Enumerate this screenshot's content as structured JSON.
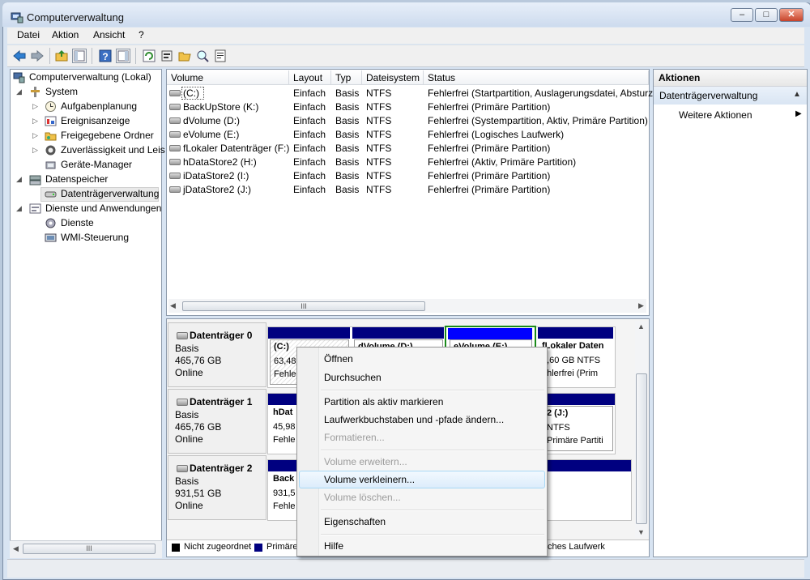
{
  "window": {
    "title": "Computerverwaltung",
    "min": "–",
    "max": "□",
    "close": "✕"
  },
  "menu": [
    "Datei",
    "Aktion",
    "Ansicht",
    "?"
  ],
  "toolbar_icons": [
    "back-arrow-icon",
    "forward-arrow-icon",
    "up-folder-icon",
    "show-hide-tree-icon",
    "help-icon",
    "show-hide-actions-icon",
    "refresh-icon",
    "properties-icon",
    "open-folder-icon",
    "search-icon",
    "properties-sheet-icon"
  ],
  "tree": {
    "root": "Computerverwaltung (Lokal)",
    "system": "System",
    "aufgaben": "Aufgabenplanung",
    "ereignis": "Ereignisanzeige",
    "freigabe": "Freigegebene Ordner",
    "zuverl": "Zuverlässigkeit und Leis",
    "geraete": "Geräte-Manager",
    "datenspeicher": "Datenspeicher",
    "datentraeger": "Datenträgerverwaltung",
    "dienste_anw": "Dienste und Anwendungen",
    "dienste": "Dienste",
    "wmi": "WMI-Steuerung"
  },
  "columns": {
    "volume": "Volume",
    "layout": "Layout",
    "typ": "Typ",
    "fs": "Dateisystem",
    "status": "Status"
  },
  "rows": [
    {
      "volume": "(C:)",
      "layout": "Einfach",
      "typ": "Basis",
      "fs": "NTFS",
      "status": "Fehlerfrei (Startpartition, Auslagerungsdatei, Absturz"
    },
    {
      "volume": "BackUpStore (K:)",
      "layout": "Einfach",
      "typ": "Basis",
      "fs": "NTFS",
      "status": "Fehlerfrei (Primäre Partition)"
    },
    {
      "volume": "dVolume (D:)",
      "layout": "Einfach",
      "typ": "Basis",
      "fs": "NTFS",
      "status": "Fehlerfrei (Systempartition, Aktiv, Primäre Partition)"
    },
    {
      "volume": "eVolume (E:)",
      "layout": "Einfach",
      "typ": "Basis",
      "fs": "NTFS",
      "status": "Fehlerfrei (Logisches Laufwerk)"
    },
    {
      "volume": "fLokaler Datenträger (F:)",
      "layout": "Einfach",
      "typ": "Basis",
      "fs": "NTFS",
      "status": "Fehlerfrei (Primäre Partition)"
    },
    {
      "volume": "hDataStore2 (H:)",
      "layout": "Einfach",
      "typ": "Basis",
      "fs": "NTFS",
      "status": "Fehlerfrei (Aktiv, Primäre Partition)"
    },
    {
      "volume": "iDataStore2 (I:)",
      "layout": "Einfach",
      "typ": "Basis",
      "fs": "NTFS",
      "status": "Fehlerfrei (Primäre Partition)"
    },
    {
      "volume": "jDataStore2 (J:)",
      "layout": "Einfach",
      "typ": "Basis",
      "fs": "NTFS",
      "status": "Fehlerfrei (Primäre Partition)"
    }
  ],
  "hscroll_grip": "III",
  "disks": [
    {
      "name": "Datenträger 0",
      "type": "Basis",
      "size": "465,76 GB",
      "state": "Online"
    },
    {
      "name": "Datenträger 1",
      "type": "Basis",
      "size": "465,76 GB",
      "state": "Online"
    },
    {
      "name": "Datenträger 2",
      "type": "Basis",
      "size": "931,51 GB",
      "state": "Online"
    }
  ],
  "partitions": {
    "d0p1": {
      "title": "(C:)",
      "l1": "63,48",
      "l2": "Fehle"
    },
    "d0p2": {
      "title": "dVolume (D:)"
    },
    "d0p3": {
      "title": "eVolume (E:)"
    },
    "d0p4": {
      "title": "fLokaler Daten",
      "l1": "0,60 GB NTFS",
      "l2": "ehlerfrei (Prim"
    },
    "d1p1": {
      "title": "hDat",
      "l1": "45,98",
      "l2": "Fehle"
    },
    "d1p2": {
      "title": "2  (J:)",
      "l1": "NTFS",
      "l2": "Primäre Partiti"
    },
    "d2p1": {
      "title": "Back",
      "l1": "931,5",
      "l2": "Fehle"
    }
  },
  "legend": {
    "unallocated": "Nicht zugeordnet",
    "primary": "Primäre",
    "logical": "ches Laufwerk"
  },
  "legend_colors": {
    "unallocated": "#000000",
    "primary": "#000080",
    "logical": "#0000ff",
    "extended_frame": "#1a8a1a"
  },
  "actions": {
    "header": "Aktionen",
    "section": "Datenträgerverwaltung",
    "more": "Weitere Aktionen"
  },
  "context_menu": {
    "open": "Öffnen",
    "browse": "Durchsuchen",
    "mark_active": "Partition als aktiv markieren",
    "change_letter": "Laufwerkbuchstaben und -pfade ändern...",
    "format": "Formatieren...",
    "extend": "Volume erweitern...",
    "shrink": "Volume verkleinern...",
    "delete": "Volume löschen...",
    "properties": "Eigenschaften",
    "help": "Hilfe"
  }
}
